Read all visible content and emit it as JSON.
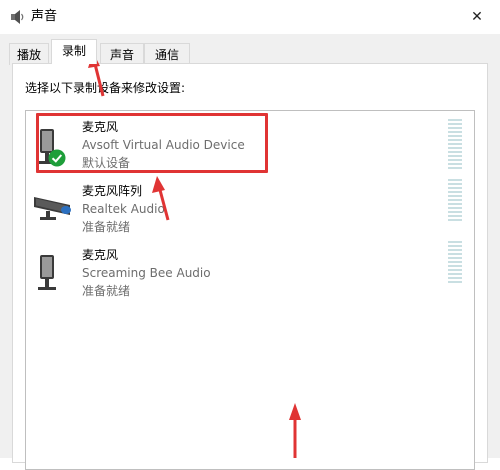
{
  "window": {
    "title": "声音",
    "close_symbol": "✕"
  },
  "tabs": [
    {
      "label": "播放",
      "selected": false
    },
    {
      "label": "录制",
      "selected": true
    },
    {
      "label": "声音",
      "selected": false
    },
    {
      "label": "通信",
      "selected": false
    }
  ],
  "instruction": "选择以下录制设备来修改设置:",
  "devices": [
    {
      "name": "麦克风",
      "description": "Avsoft Virtual Audio Device",
      "status": "默认设备",
      "icon": "microphone-icon",
      "default": true
    },
    {
      "name": "麦克风阵列",
      "description": "Realtek Audio",
      "status": "准备就绪",
      "icon": "microphone-array-icon",
      "default": false
    },
    {
      "name": "麦克风",
      "description": "Screaming Bee Audio",
      "status": "准备就绪",
      "icon": "microphone-icon",
      "default": false
    }
  ],
  "colors": {
    "annotation_red": "#e03434",
    "default_check_green": "#1e9e3a",
    "meter_color": "#c9dfe2"
  }
}
